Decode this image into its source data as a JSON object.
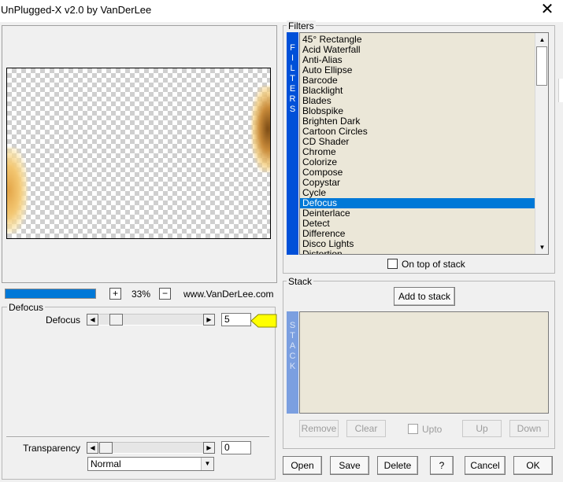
{
  "window": {
    "title": "UnPlugged-X v2.0 by VanDerLee",
    "close_symbol": "✕"
  },
  "preview": {
    "zoom_plus": "+",
    "zoom_value": "33%",
    "zoom_minus": "−",
    "site": "www.VanDerLee.com",
    "progress_fraction": 1.0
  },
  "defocus_group": {
    "title": "Defocus",
    "params": [
      {
        "label": "Defocus",
        "value": "5",
        "slider_fraction": 0.03
      }
    ],
    "transparency": {
      "label": "Transparency",
      "value": "0",
      "slider_fraction": 0.0
    },
    "blend_mode": "Normal"
  },
  "filters": {
    "title": "Filters",
    "bar_letters": [
      "F",
      "I",
      "L",
      "T",
      "E",
      "R",
      "S"
    ],
    "items": [
      "45° Rectangle",
      "Acid Waterfall",
      "Anti-Alias",
      "Auto Ellipse",
      "Barcode",
      "Blacklight",
      "Blades",
      "Blobspike",
      "Brighten Dark",
      "Cartoon Circles",
      "CD Shader",
      "Chrome",
      "Colorize",
      "Compose",
      "Copystar",
      "Cycle",
      "Defocus",
      "Deinterlace",
      "Detect",
      "Difference",
      "Disco Lights",
      "Distortion"
    ],
    "selected_index": 16,
    "on_top_label": "On top of stack"
  },
  "stack": {
    "title": "Stack",
    "add_label": "Add to stack",
    "bar_letters": [
      "S",
      "T",
      "A",
      "C",
      "K"
    ],
    "remove_label": "Remove",
    "clear_label": "Clear",
    "upto_label": "Upto",
    "up_label": "Up",
    "down_label": "Down"
  },
  "footer": {
    "open": "Open",
    "save": "Save",
    "delete": "Delete",
    "help": "?",
    "cancel": "Cancel",
    "ok": "OK"
  },
  "colors": {
    "accent": "#0078d7",
    "filters_bar": "#0050d8",
    "stack_bar": "#7b9fe0",
    "list_bg": "#ebe7d8",
    "marker": "#ffff00"
  }
}
